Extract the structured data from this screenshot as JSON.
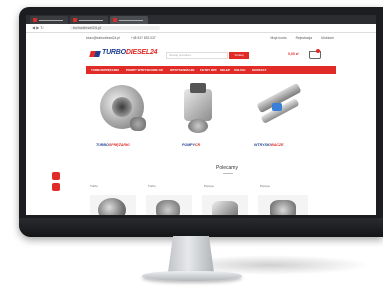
{
  "browser": {
    "url": "turbodiesel24.pl",
    "tabs": [
      "",
      "",
      "",
      "turbodiesel24.pl"
    ]
  },
  "topbar": {
    "email": "biuro@turbodiesel24.pl",
    "phone": "+48 537 833 037",
    "account": "Moje konto",
    "register": "Rejestracja",
    "wishlist": "Ulubione"
  },
  "header": {
    "logo_turbo": "TURBO",
    "logo_rest": "DIESEL24",
    "search_placeholder": "Szukaj produktu...",
    "search_button": "Szukaj",
    "cart_label": "0,00 zł"
  },
  "nav": {
    "items": [
      "TURBOSPRĘŻARKI",
      "POMPY WTRYSKOWE CR",
      "WTRYSKIWACZE",
      "FILTRY DPF",
      "SKLEP",
      "USŁUGI",
      "KONTAKT"
    ]
  },
  "categories": [
    {
      "brand_a": "TURBO",
      "brand_b": "SPRĘŻARKI"
    },
    {
      "brand_a": "POMPY",
      "brand_b": "CR"
    },
    {
      "brand_a": "WTRYSKI",
      "brand_b": "WACZE"
    }
  ],
  "section": {
    "title": "Polecamy"
  },
  "cards": [
    "Turbo",
    "Turbo",
    "Pompa",
    "Pompa"
  ],
  "colors": {
    "brand_red": "#e02b27",
    "brand_blue": "#1f3f8f"
  },
  "icons": [
    "cart-icon",
    "chat-icon"
  ]
}
